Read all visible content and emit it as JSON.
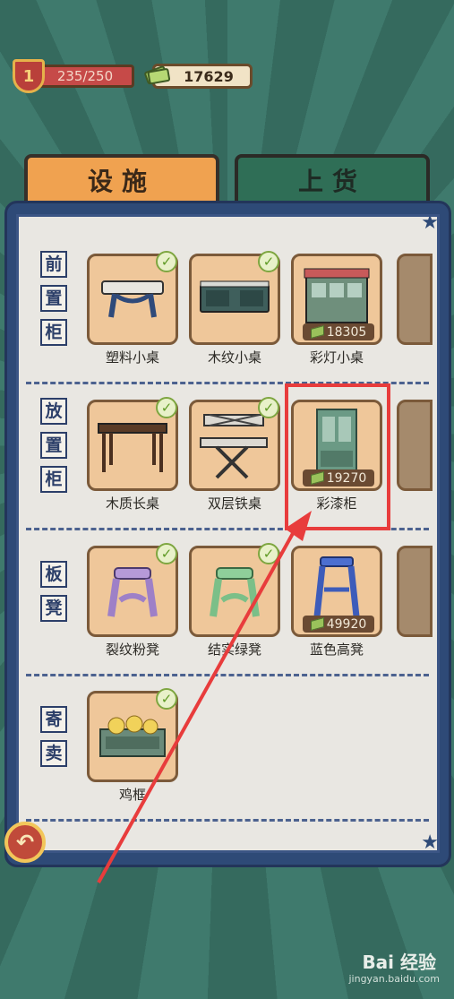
{
  "status": {
    "level": "1",
    "xp": "235/250",
    "money": "17629"
  },
  "tabs": [
    {
      "label": "设施"
    },
    {
      "label": "上货"
    }
  ],
  "sections": [
    {
      "category": [
        "前",
        "置",
        "柜"
      ],
      "items": [
        {
          "name": "塑料小桌",
          "owned": true,
          "price": ""
        },
        {
          "name": "木纹小桌",
          "owned": true,
          "price": ""
        },
        {
          "name": "彩灯小桌",
          "owned": false,
          "price": "18305"
        }
      ]
    },
    {
      "category": [
        "放",
        "置",
        "柜"
      ],
      "items": [
        {
          "name": "木质长桌",
          "owned": true,
          "price": ""
        },
        {
          "name": "双层铁桌",
          "owned": true,
          "price": ""
        },
        {
          "name": "彩漆柜",
          "owned": false,
          "price": "19270"
        }
      ]
    },
    {
      "category": [
        "板",
        "凳"
      ],
      "items": [
        {
          "name": "裂纹粉凳",
          "owned": true,
          "price": ""
        },
        {
          "name": "结实绿凳",
          "owned": true,
          "price": ""
        },
        {
          "name": "蓝色高凳",
          "owned": false,
          "price": "49920"
        }
      ]
    },
    {
      "category": [
        "寄",
        "卖"
      ],
      "items": [
        {
          "name": "鸡框",
          "owned": true,
          "price": ""
        }
      ]
    }
  ],
  "icons": {
    "back": "back-arrow-icon",
    "check": "check-icon",
    "money": "cash-icon",
    "star": "star-icon"
  },
  "colors": {
    "highlight": "#e83c3c",
    "arrow": "#e83c3c"
  },
  "watermark": {
    "brand": "Bai 经验",
    "url": "jingyan.baidu.com"
  }
}
